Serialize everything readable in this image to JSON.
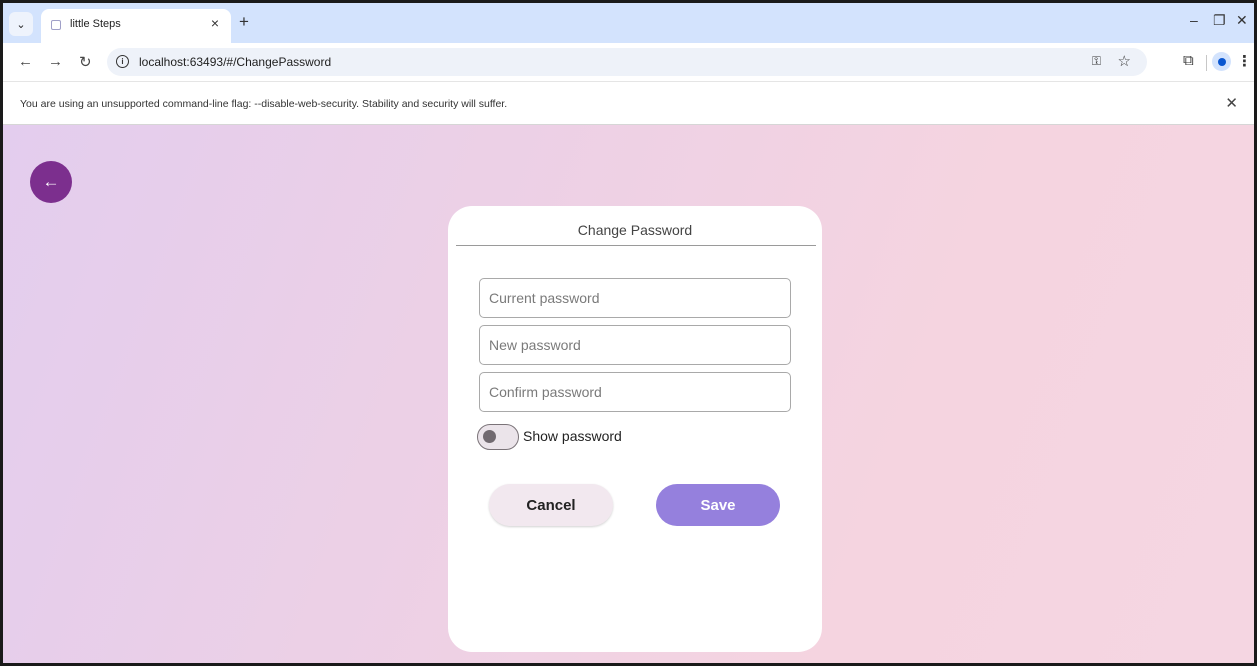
{
  "browser": {
    "tab_title": "little Steps",
    "tab_close": "×",
    "new_tab": "+",
    "url": "localhost:63493/#/ChangePassword",
    "icons": {
      "tab_search": "chevron-down-icon",
      "favicon": "page-icon",
      "back": "back-arrow-icon",
      "forward": "forward-arrow-icon",
      "reload": "reload-icon",
      "site_info": "info-icon",
      "password_key": "key-icon",
      "bookmark": "star-icon",
      "extensions": "puzzle-icon",
      "profile": "profile-icon",
      "menu": "kebab-menu-icon",
      "minimize": "minimize-icon",
      "restore": "restore-icon",
      "close": "close-icon"
    }
  },
  "infobar": {
    "message": "You are using an unsupported command-line flag: --disable-web-security. Stability and security will suffer."
  },
  "page": {
    "back_icon": "arrow-left-icon",
    "card": {
      "title": "Change Password",
      "current_password_placeholder": "Current password",
      "new_password_placeholder": "New password",
      "confirm_password_placeholder": "Confirm password",
      "show_password_label": "Show password",
      "show_password_on": false,
      "cancel_label": "Cancel",
      "save_label": "Save"
    }
  },
  "colors": {
    "back_button": "#7c2f8e",
    "save_button": "#9580dd",
    "cancel_button": "#f2e8ef",
    "background_start": "#e3cdee",
    "background_end": "#f5d6e2",
    "tabstrip": "#d3e3fd"
  }
}
